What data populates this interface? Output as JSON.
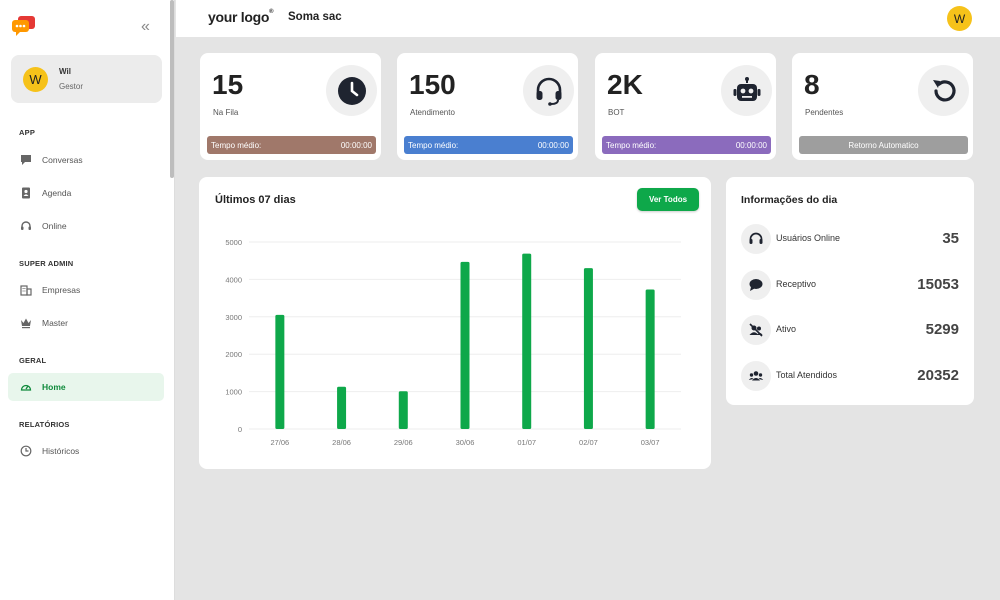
{
  "sidebar": {
    "user": {
      "initial": "W",
      "name": "Wil",
      "role": "Gestor"
    },
    "sections": {
      "app": "APP",
      "super_admin": "SUPER ADMIN",
      "geral": "GERAL",
      "relatorios": "RELATÓRIOS"
    },
    "items": {
      "conversas": "Conversas",
      "agenda": "Agenda",
      "online": "Online",
      "empresas": "Empresas",
      "master": "Master",
      "home": "Home",
      "historicos": "Históricos"
    },
    "active_item": "Home"
  },
  "topbar": {
    "logo_text": "your logo",
    "logo_mark": "®",
    "page_name": "Soma sac",
    "avatar_initial": "W"
  },
  "cards": [
    {
      "value": "15",
      "label": "Na Fila",
      "icon": "clock-icon",
      "bar_label": "Tempo médio:",
      "bar_value": "00:00:00",
      "bar_color": "#a0786a"
    },
    {
      "value": "150",
      "label": "Atendimento",
      "icon": "headset-icon",
      "bar_label": "Tempo médio:",
      "bar_value": "00:00:00",
      "bar_color": "#4a7fd0"
    },
    {
      "value": "2K",
      "label": "BOT",
      "icon": "robot-icon",
      "bar_label": "Tempo médio:",
      "bar_value": "00:00:00",
      "bar_color": "#8b6bbd"
    },
    {
      "value": "8",
      "label": "Pendentes",
      "icon": "refresh-icon",
      "bar_label": "Retorno Automatico",
      "bar_value": "",
      "bar_color": "#9e9e9e"
    }
  ],
  "chart_panel": {
    "title": "Últimos 07 dias",
    "button": "Ver Todos"
  },
  "chart_data": {
    "type": "bar",
    "categories": [
      "27/06",
      "28/06",
      "29/06",
      "30/06",
      "01/07",
      "02/07",
      "03/07"
    ],
    "values": [
      3050,
      1130,
      1010,
      4470,
      4690,
      4300,
      3730
    ],
    "ylim": [
      0,
      5000
    ],
    "yticks": [
      0,
      1000,
      2000,
      3000,
      4000,
      5000
    ],
    "grid": true,
    "bar_color": "#0ea84a"
  },
  "info": {
    "title": "Informações do dia",
    "rows": [
      {
        "label": "Usuários Online",
        "value": "35",
        "icon": "headset-icon"
      },
      {
        "label": "Receptivo",
        "value": "15053",
        "icon": "chat-bubble-icon"
      },
      {
        "label": "Ativo",
        "value": "5299",
        "icon": "muted-users-icon"
      },
      {
        "label": "Total Atendidos",
        "value": "20352",
        "icon": "users-group-icon"
      }
    ]
  }
}
